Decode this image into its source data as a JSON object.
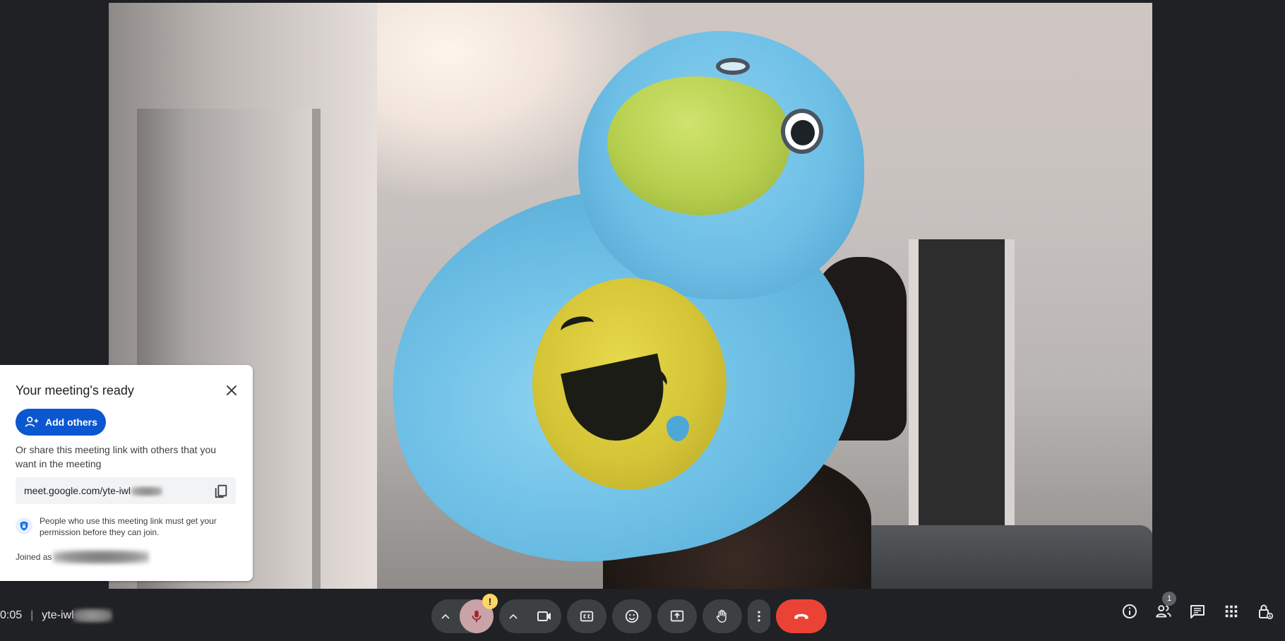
{
  "card": {
    "title": "Your meeting's ready",
    "add_label": "Add others",
    "share_text": "Or share this meeting link with others that you want in the meeting",
    "link_visible": "meet.google.com/yte-iwl",
    "permission_text": "People who use this meeting link must get your permission before they can join.",
    "joined_label": "Joined as"
  },
  "bottom": {
    "time": "0:05",
    "separator": "|",
    "meeting_code_visible": "yte-iwl",
    "participant_count": "1",
    "warning_glyph": "!"
  },
  "icons": {
    "close": "close-icon",
    "add_person": "person-add-icon",
    "copy": "copy-icon",
    "shield": "shield-lock-icon",
    "mic": "mic-icon",
    "camera": "videocam-icon",
    "captions": "closed-captions-icon",
    "emoji": "emoji-icon",
    "present": "present-screen-icon",
    "hand": "raise-hand-icon",
    "more": "more-vert-icon",
    "end_call": "call-end-icon",
    "info": "info-icon",
    "people": "people-icon",
    "chat": "chat-icon",
    "activities": "apps-grid-icon",
    "host_controls": "lock-person-icon"
  },
  "colors": {
    "background": "#202124",
    "control_bg": "#3c4043",
    "mic_active": "#c9a3a7",
    "end_call": "#ea4335",
    "primary_button": "#0b57d0",
    "warning_badge": "#fdd663"
  }
}
